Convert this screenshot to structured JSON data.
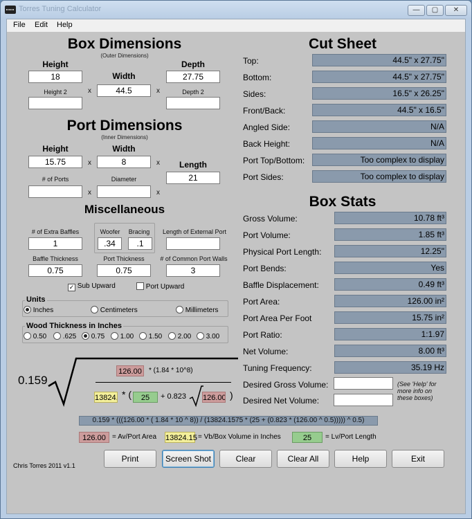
{
  "window": {
    "title": "Torres Tuning Calculator",
    "btn_min": "—",
    "btn_max": "▢",
    "btn_close": "✕"
  },
  "menu": [
    "File",
    "Edit",
    "Help"
  ],
  "box": {
    "title": "Box Dimensions",
    "subtitle": "(Outer Dimensions)",
    "height_label": "Height",
    "width_label": "Width",
    "depth_label": "Depth",
    "height2_label": "Height 2",
    "depth2_label": "Depth 2",
    "height": "18",
    "width": "44.5",
    "depth": "27.75",
    "height2": "",
    "depth2": "",
    "mul": "x"
  },
  "port": {
    "title": "Port Dimensions",
    "subtitle": "(Inner Dimensions)",
    "height_label": "Height",
    "width_label": "Width",
    "length_label": "Length",
    "ports_label": "# of Ports",
    "diameter_label": "Diameter",
    "height": "15.75",
    "width": "8",
    "length": "21",
    "ports": "",
    "diameter": ""
  },
  "misc": {
    "title": "Miscellaneous",
    "baffles_label": "# of Extra Baffles",
    "woofer_label": "Woofer",
    "bracing_label": "Bracing",
    "ext_port_label": "Length of External Port",
    "baffle_thick_label": "Baffle Thickness",
    "port_thick_label": "Port Thickness",
    "common_walls_label": "# of Common Port Walls",
    "baffles": "1",
    "woofer": ".34",
    "bracing": ".1",
    "ext_port": "",
    "baffle_thick": "0.75",
    "port_thick": "0.75",
    "common_walls": "3",
    "sub_upward": "Sub Upward",
    "port_upward": "Port Upward"
  },
  "units": {
    "title": "Units",
    "options": [
      "Inches",
      "Centimeters",
      "Millimeters"
    ],
    "selected": 0
  },
  "wood": {
    "title": "Wood Thickness in Inches",
    "options": [
      "0.50",
      ".625",
      "0.75",
      "1.00",
      "1.50",
      "2.00",
      "3.00"
    ],
    "selected": 2
  },
  "cut_sheet": {
    "title": "Cut Sheet",
    "rows": [
      {
        "label": "Top:",
        "value": "44.5\" x 27.75\""
      },
      {
        "label": "Bottom:",
        "value": "44.5\" x 27.75\""
      },
      {
        "label": "Sides:",
        "value": "16.5\" x 26.25\""
      },
      {
        "label": "Front/Back:",
        "value": "44.5\" x 16.5\""
      },
      {
        "label": "Angled Side:",
        "value": "N/A"
      },
      {
        "label": "Back Height:",
        "value": "N/A"
      },
      {
        "label": "Port Top/Bottom:",
        "value": "Too complex to display"
      },
      {
        "label": "Port Sides:",
        "value": "Too complex to display"
      }
    ]
  },
  "stats": {
    "title": "Box Stats",
    "rows": [
      {
        "label": "Gross Volume:",
        "value": "10.78 ft³"
      },
      {
        "label": "Port Volume:",
        "value": "1.85 ft³"
      },
      {
        "label": "Physical Port Length:",
        "value": "12.25\""
      },
      {
        "label": "Port Bends:",
        "value": "Yes"
      },
      {
        "label": "Baffle Displacement:",
        "value": "0.49 ft³"
      },
      {
        "label": "Port Area:",
        "value": "126.00 in²"
      },
      {
        "label": "Port Area Per Foot",
        "value": "15.75 in²"
      },
      {
        "label": "Port Ratio:",
        "value": "1:1.97"
      },
      {
        "label": "Net Volume:",
        "value": "8.00 ft³"
      },
      {
        "label": "Tuning Frequency:",
        "value": "35.19 Hz"
      }
    ],
    "desired_gross_label": "Desired Gross Volume:",
    "desired_net_label": "Desired Net Volume:",
    "desired_gross": "",
    "desired_net": "",
    "note": "(See 'Help' for more info on these boxes)"
  },
  "formula": {
    "coef": "0.159",
    "av": "126.00",
    "numer_rest": "* (1.84 * 10^8)",
    "vb": "13824.15",
    "open": "* (",
    "lv": "25",
    "plus": "+ 0.823",
    "close": ")",
    "full": "0.159 * (((126.00 * ( 1.84 * 10 ^ 8)) / (13824.1575 * (25 + (0.823 * (126.00 ^ 0.5))))) ^ 0.5)",
    "legend_av": "= Av/Port Area",
    "legend_vb": "= Vb/Box Volume in Inches",
    "legend_lv": "= Lv/Port Length"
  },
  "footer": {
    "credit": "Chris Torres 2011 v1.1"
  },
  "buttons": [
    "Print",
    "Screen Shot",
    "Clear",
    "Clear All",
    "Help",
    "Exit"
  ]
}
